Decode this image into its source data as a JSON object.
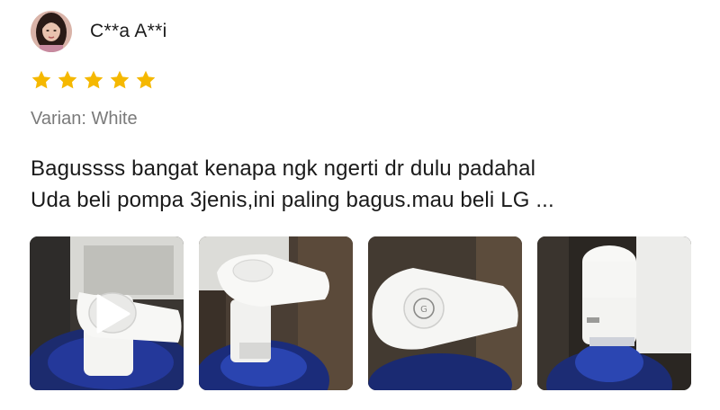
{
  "reviewer": {
    "name": "C**a A**i",
    "avatar_icon": "profile-photo"
  },
  "rating": {
    "stars": 5,
    "max": 5,
    "color": "#f5b800"
  },
  "variant_text": "Varian: White",
  "review": {
    "lines": [
      "Bagussss bangat kenapa ngk ngerti dr dulu padahal",
      "Uda beli pompa 3jenis,ini paling bagus.mau beli LG ..."
    ]
  },
  "media": [
    {
      "kind": "video",
      "icon": "play-icon"
    },
    {
      "kind": "photo"
    },
    {
      "kind": "photo"
    },
    {
      "kind": "photo"
    }
  ]
}
